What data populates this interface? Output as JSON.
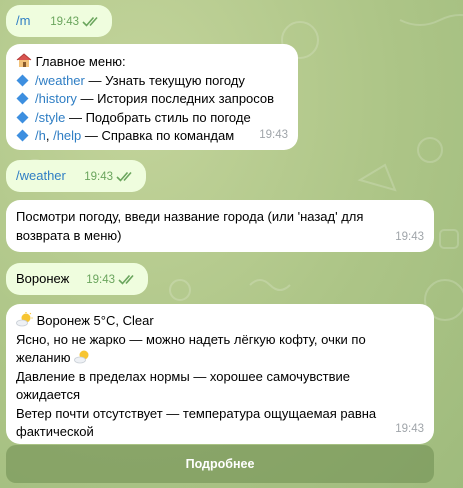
{
  "messages": {
    "m1": {
      "text": "/m",
      "time": "19:43"
    },
    "menu": {
      "title": "Главное меню:",
      "items": [
        {
          "cmd": "/weather",
          "desc": " — Узнать текущую погоду"
        },
        {
          "cmd": "/history",
          "desc": " — История последних запросов"
        },
        {
          "cmd": "/style",
          "desc": " — Подобрать стиль по погоде"
        },
        {
          "cmd": "/h",
          "sep": ", ",
          "cmd2": "/help",
          "desc": " — Справка по командам"
        }
      ],
      "time": "19:43"
    },
    "m3": {
      "text": "/weather",
      "time": "19:43"
    },
    "prompt": {
      "line1": "Посмотри погоду, введи название города (или 'назад' для",
      "line2": "возврата в меню)",
      "time": "19:43"
    },
    "m5": {
      "text": "Воронеж",
      "time": "19:43"
    },
    "result": {
      "header": "Воронеж 5°C, Clear",
      "line1": "Ясно, но не жарко — можно надеть лёгкую кофту, очки по",
      "line2": "желанию",
      "line3": "Давление в пределах нормы — хорошее самочувствие",
      "line4": "ожидается",
      "line5": "Ветер почти отсутствует — температура ощущаемая равна",
      "line6": "фактической",
      "time": "19:43"
    }
  },
  "button": {
    "label": "Подробнее"
  },
  "colors": {
    "outgoing_bubble": "#effdde",
    "incoming_bubble": "#ffffff",
    "link": "#2f7ec4",
    "check": "#6aa55d"
  },
  "icons": [
    "double-check-icon",
    "house-icon",
    "blue-diamond-icon",
    "sun-behind-cloud-icon"
  ]
}
